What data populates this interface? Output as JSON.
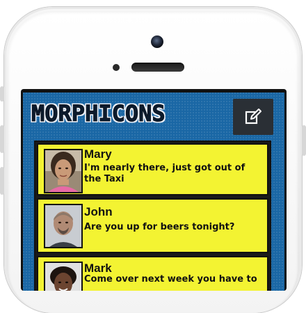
{
  "app": {
    "title": "Morphicons",
    "compose_icon": "compose-icon"
  },
  "conversations": [
    {
      "name": "Mary",
      "message": "I'm nearly there, just got out of the Taxi",
      "avatar": "avatar-woman"
    },
    {
      "name": "John",
      "message": "Are you up for beers tonight?",
      "avatar": "avatar-man-bald"
    },
    {
      "name": "Mark",
      "message": "Come over next week you have to",
      "avatar": "avatar-man-curly"
    }
  ],
  "colors": {
    "background_blue": "#1a67a5",
    "card_yellow": "#f3f332",
    "compose_bg": "#2a2f35"
  }
}
